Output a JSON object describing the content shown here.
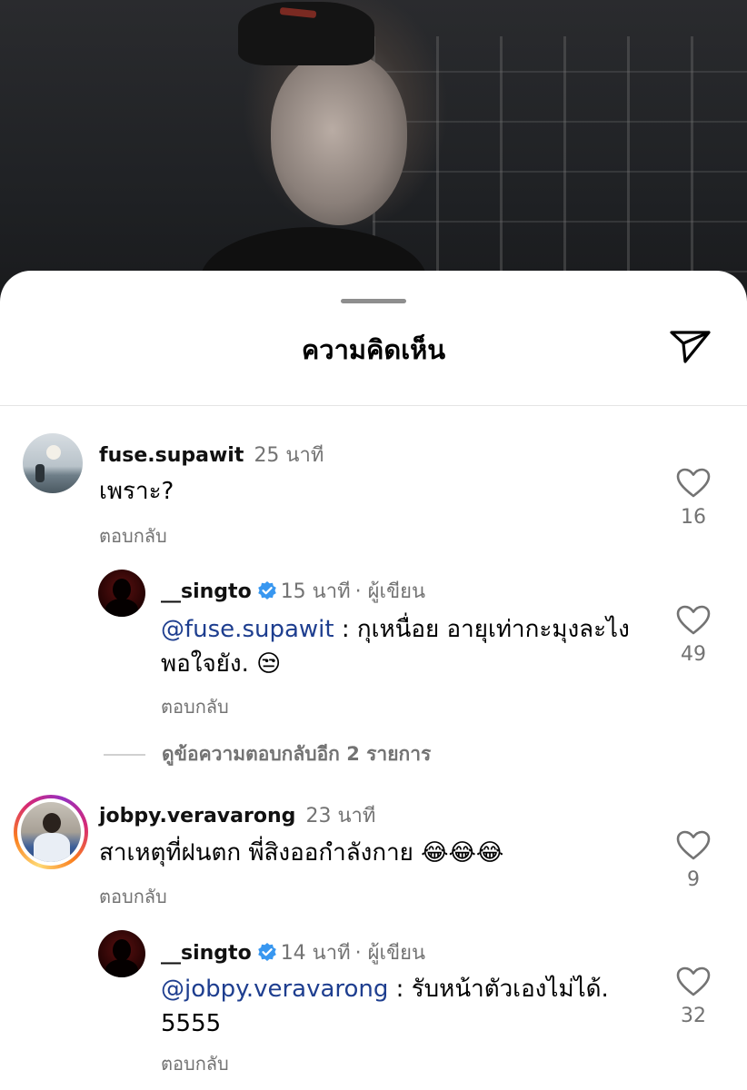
{
  "sheet": {
    "title": "ความคิดเห็น",
    "share_icon": "paper-plane-icon"
  },
  "comments": [
    {
      "username": "fuse.supawit",
      "time": "25 นาที",
      "text": "เพราะ?",
      "reply_label": "ตอบกลับ",
      "likes": "16"
    },
    {
      "username": "__singto",
      "verified": true,
      "time": "15 นาที",
      "author_label": "· ผู้เขียน",
      "mention": "@fuse.supawit",
      "text": " : กุเหนื่อย อายุเท่ากะมุงละไง พอใจยัง. 😒",
      "reply_label": "ตอบกลับ",
      "likes": "49"
    },
    {
      "username": "jobpy.veravarong",
      "time": "23 นาที",
      "text": "สาเหตุที่ฝนตก  พี่สิงออกำลังกาย 😂😂😂",
      "reply_label": "ตอบกลับ",
      "likes": "9"
    },
    {
      "username": "__singto",
      "verified": true,
      "time": "14 นาที",
      "author_label": "· ผู้เขียน",
      "mention": "@jobpy.veravarong",
      "text": " : รับหน้าตัวเองไม่ได้. 5555",
      "reply_label": "ตอบกลับ",
      "likes": "32"
    }
  ],
  "view_more_replies": "ดูข้อความตอบกลับอีก 2 รายการ",
  "colors": {
    "mention": "#1e3e8f",
    "verified": "#3897f0",
    "muted": "#737373"
  }
}
